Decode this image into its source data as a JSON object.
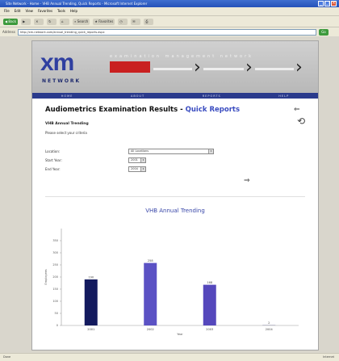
{
  "window": {
    "title": "Site Network - Home - VHB Annual Trending, Quick Reports - Microsoft Internet Explorer"
  },
  "menu": [
    "File",
    "Edit",
    "View",
    "Favorites",
    "Tools",
    "Help"
  ],
  "toolbar": {
    "back": "Back",
    "search": "Search",
    "favorites": "Favorites"
  },
  "address": {
    "label": "Address",
    "url": "http://xm-network.com/annual_trending_quick_reports.aspx",
    "go": "Go"
  },
  "banner": {
    "logo_xm": "xm",
    "logo_network": "NETWORK",
    "tagline": "examination management network",
    "nav_items": [
      "HOME",
      "ABOUT",
      "REPORTS",
      "HELP"
    ]
  },
  "page": {
    "title": "Audiometrics Examination Results",
    "title_separator": " - ",
    "title_link": "Quick Reports",
    "subtitle": "VHB Annual Trending",
    "instructions": "Please select your criteria"
  },
  "form": {
    "location_label": "Location:",
    "location_value": "All Locations",
    "start_year_label": "Start Year:",
    "start_year_value": "2001",
    "end_year_label": "End Year:",
    "end_year_value": "2004"
  },
  "chart_data": {
    "type": "bar",
    "title": "VHB Annual Trending",
    "categories": [
      "2001",
      "2002",
      "2003",
      "2004"
    ],
    "values": [
      190,
      258,
      168,
      2
    ],
    "colors": [
      "#131a5e",
      "#5b52c4",
      "#5548bc",
      "#9a9ab0"
    ],
    "ylim": [
      0,
      400
    ],
    "yticks": [
      0,
      50,
      100,
      150,
      200,
      250,
      300,
      350
    ],
    "ylabel": "Employees",
    "xlabel": "Year",
    "grid": false
  },
  "statusbar": {
    "text": "Done",
    "zone": "Internet"
  }
}
